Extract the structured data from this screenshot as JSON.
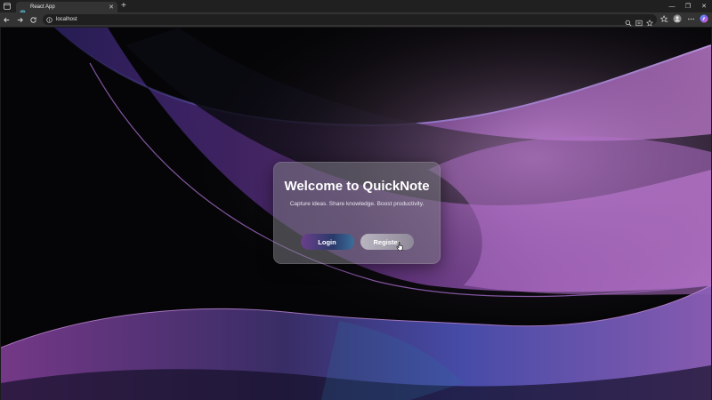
{
  "browser": {
    "tab_title": "React App",
    "url": "localhost",
    "icons": {
      "tab_actions": "tab-actions-icon",
      "favicon": "react-favicon-icon",
      "close_tab": "close-icon",
      "new_tab": "plus-icon",
      "minimize": "minimize-icon",
      "maximize": "restore-icon",
      "close_window": "close-window-icon",
      "back": "back-arrow-icon",
      "forward": "forward-arrow-icon",
      "reload": "reload-icon",
      "site_info": "info-icon",
      "zoom": "zoom-icon",
      "read_aloud": "reader-icon",
      "favorite": "star-icon",
      "favorites_bar": "favorites-icon",
      "profile": "profile-avatar-icon",
      "more": "more-dots-icon",
      "copilot": "copilot-icon"
    }
  },
  "page": {
    "heading": "Welcome to QuickNote",
    "tagline": "Capture ideas. Share knowledge. Boost productivity.",
    "login_label": "Login",
    "register_label": "Register"
  },
  "colors": {
    "page_background": "#050507",
    "wave_purple": "#a45fc0",
    "wave_blue": "#4a4fb0",
    "card_background": "#78787f",
    "login_gradient_start": "#6b3f8c",
    "login_gradient_end": "#3a6f9c",
    "register_background": "#b9b5c0"
  }
}
